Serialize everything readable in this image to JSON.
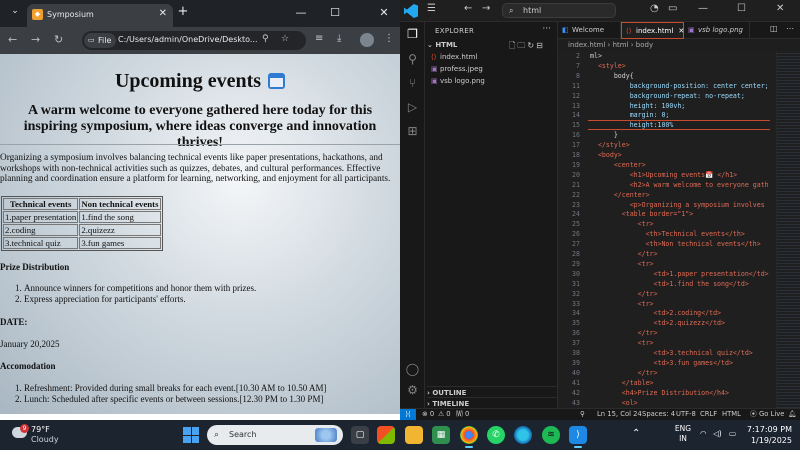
{
  "browser": {
    "tab_title": "Symposium",
    "tab_close": "✕",
    "new_tab": "+",
    "window_controls": [
      "⌄",
      "—",
      "☐",
      "✕"
    ],
    "file_chip": "File",
    "url": "C:/Users/admin/OneDrive/Deskto...",
    "icons": [
      "back-arrow",
      "forward-arrow",
      "reload",
      "page-info",
      "zoom",
      "bookmark-star",
      "extensions",
      "download",
      "profile-avatar",
      "menu-kebab"
    ]
  },
  "page": {
    "title": "Upcoming events",
    "subtitle": "A warm welcome to everyone gathered here today for this inspiring symposium, where ideas converge and innovation thrives!",
    "intro": "Organizing a symposium involves balancing technical events like paper presentations, hackathons, and workshops with non-technical activities such as quizzes, debates, and cultural performances. Effective planning and coordination ensure a platform for learning, networking, and enjoyment for all participants.",
    "table": {
      "headers": [
        "Technical events",
        "Non technical events"
      ],
      "rows": [
        [
          "1.paper presentation",
          "1.find the song"
        ],
        [
          "2.coding",
          "2.quizezz"
        ],
        [
          "3.technical quiz",
          "3.fun games"
        ]
      ]
    },
    "prize_heading": "Prize Distribution",
    "prize_items": [
      "Announce winners for competitions and honor them with prizes.",
      "Express appreciation for participants' efforts."
    ],
    "date_heading": "DATE:",
    "date_value": "January 20,2025",
    "accom_heading": "Accomodation",
    "accom_items": [
      "Refreshment: Provided during small breaks for each event.[10.30 AM to 10.50 AM]",
      "Lunch: Scheduled after specific events or between sessions.[12.30 PM to 1.30 PM]"
    ]
  },
  "vscode": {
    "command_center": "html",
    "explorer_label": "EXPLORER",
    "explorer_more": "···",
    "folder": "HTML",
    "files": [
      "index.html",
      "profess.jpeg",
      "vsb logo.png"
    ],
    "outline_label": "OUTLINE",
    "timeline_label": "TIMELINE",
    "tabs": [
      "Welcome",
      "index.html",
      "vsb logo.png"
    ],
    "breadcrumb": [
      "index.html",
      "html",
      "body"
    ],
    "code_lines": [
      {
        "n": "2",
        "t": "ml>"
      },
      {
        "n": "7",
        "t": "  <style>"
      },
      {
        "n": "8",
        "t": "      body{"
      },
      {
        "n": "11",
        "t": "          background-position: center center;"
      },
      {
        "n": "12",
        "t": "          background-repeat: no-repeat;"
      },
      {
        "n": "13",
        "t": "          height: 100vh;"
      },
      {
        "n": "14",
        "t": "          margin: 0;"
      },
      {
        "n": "15",
        "t": "          height:100%"
      },
      {
        "n": "16",
        "t": "      }"
      },
      {
        "n": "17",
        "t": "  </style>"
      },
      {
        "n": "18",
        "t": "  <body>"
      },
      {
        "n": "19",
        "t": "      <center>"
      },
      {
        "n": "20",
        "t": "          <h1>Upcoming events📅 </h1>"
      },
      {
        "n": "21",
        "t": "          <h2>A warm welcome to everyone gath"
      },
      {
        "n": "22",
        "t": "      </center>"
      },
      {
        "n": "23",
        "t": "          <p>Organizing a symposium involves"
      },
      {
        "n": "24",
        "t": "        <table border=\"1\">"
      },
      {
        "n": "25",
        "t": "            <tr>"
      },
      {
        "n": "26",
        "t": "              <th>Technical events</th>"
      },
      {
        "n": "27",
        "t": "              <th>Non technical events</th>"
      },
      {
        "n": "28",
        "t": "            </tr>"
      },
      {
        "n": "29",
        "t": "            <tr>"
      },
      {
        "n": "30",
        "t": "                <td>1.paper presentation</td>"
      },
      {
        "n": "31",
        "t": "                <td>1.find the song</td>"
      },
      {
        "n": "32",
        "t": "            </tr>"
      },
      {
        "n": "33",
        "t": "            <tr>"
      },
      {
        "n": "34",
        "t": "                <td>2.coding</td>"
      },
      {
        "n": "35",
        "t": "                <td>2.quizezz</td>"
      },
      {
        "n": "36",
        "t": "            </tr>"
      },
      {
        "n": "37",
        "t": "            <tr>"
      },
      {
        "n": "38",
        "t": "                <td>3.technical quiz</td>"
      },
      {
        "n": "39",
        "t": "                <td>3.fun games</td>"
      },
      {
        "n": "40",
        "t": "            </tr>"
      },
      {
        "n": "41",
        "t": "        </table>"
      },
      {
        "n": "42",
        "t": "        <h4>Prize Distribution</h4>"
      },
      {
        "n": "43",
        "t": "        <ol>"
      }
    ],
    "highlight_line": "15",
    "status": {
      "errors": "⊗ 0",
      "warnings": "⚠ 0",
      "ports": "🄦 0",
      "position": "Ln 15, Col 24",
      "spaces": "Spaces: 4",
      "encoding": "UTF-8",
      "eol": "CRLF",
      "language": "HTML",
      "golive": "⦿ Go Live"
    }
  },
  "taskbar": {
    "weather_badge": "9",
    "temp": "79°F",
    "condition": "Cloudy",
    "search_placeholder": "Search",
    "lang_top": "ENG",
    "lang_bottom": "IN",
    "time": "7:17:09 PM",
    "date": "1/19/2025",
    "accent": "#60cdff"
  }
}
